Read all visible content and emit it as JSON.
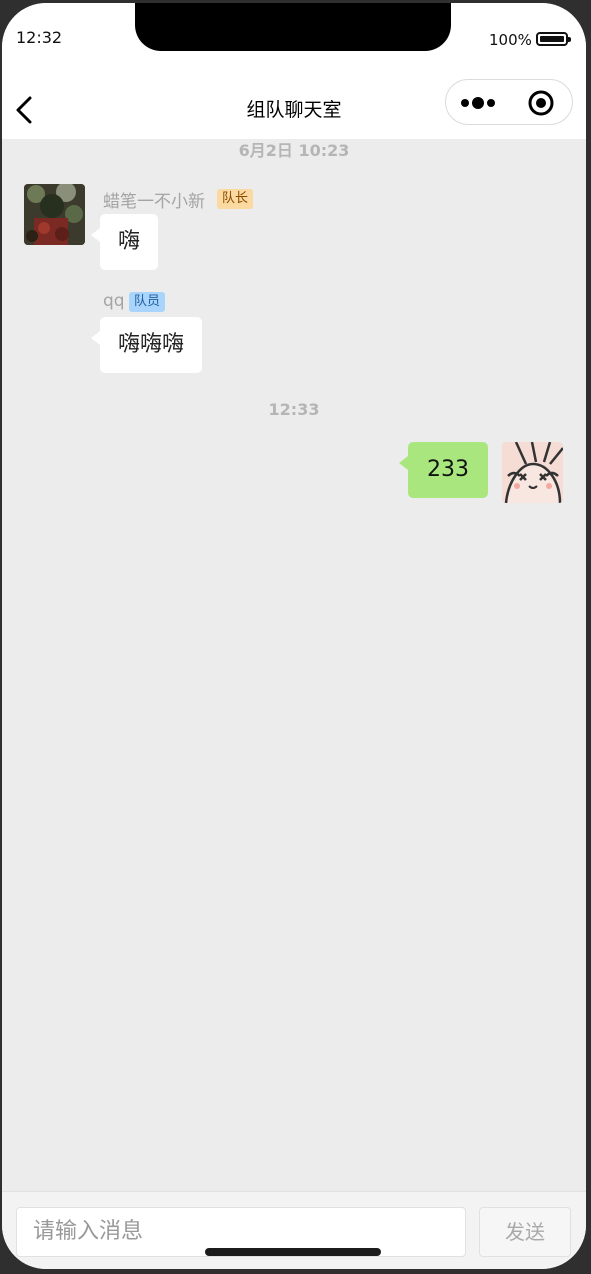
{
  "status_bar": {
    "time": "12:32",
    "battery": "100%"
  },
  "nav": {
    "title": "组队聊天室"
  },
  "messages": [
    {
      "timestamp": "6月2日 10:23"
    },
    {
      "sender": "蜡笔一不小新",
      "role": "队长",
      "text": "嗨",
      "side": "left"
    },
    {
      "sender": "qq",
      "role": "队员",
      "text": "嗨嗨嗨",
      "side": "left"
    },
    {
      "timestamp": "12:33"
    },
    {
      "text": "233",
      "side": "right"
    }
  ],
  "input": {
    "placeholder": "请输入消息",
    "send_label": "发送"
  },
  "colors": {
    "background": "#ececec",
    "own_bubble": "#a9e77e",
    "leader_tag": "#fbd9a0",
    "member_tag": "#a9d4fb"
  }
}
